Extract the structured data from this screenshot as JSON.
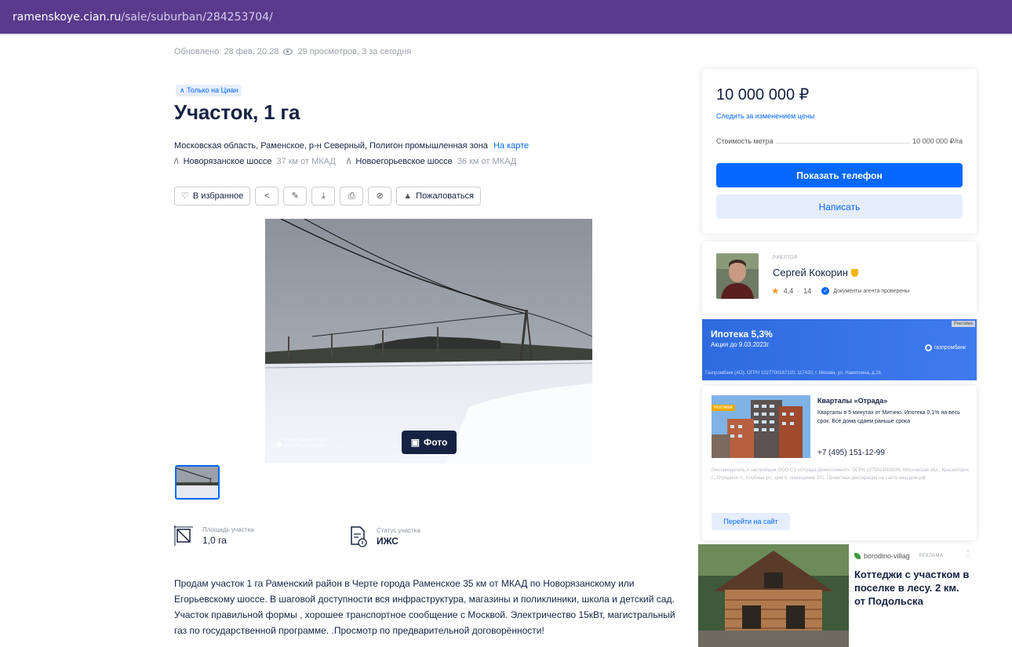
{
  "browser": {
    "url_host": "ramenskoye.cian.ru",
    "url_path": "/sale/suburban/284253704/"
  },
  "meta": {
    "updated": "Обновлено: 28 фев, 20:28",
    "views": "29 просмотров, 3 за сегодня"
  },
  "listing": {
    "badge": "Только на Циан",
    "title": "Участок, 1 га",
    "address": "Московская область, Раменское, р-н Северный, Полигон промышленная зона",
    "map_link": "На карте",
    "highways": [
      {
        "name": "Новорязанское шоссе",
        "distance": "37 км от МКАД"
      },
      {
        "name": "Новоегорьевское шоссе",
        "distance": "36 км от МКАД"
      }
    ]
  },
  "actions": {
    "favorite": "В избранное",
    "complain": "Пожаловаться"
  },
  "photo": {
    "button_label": "Фото",
    "watermark_line1": "SHOT ON MI 11 LE",
    "watermark_line2": "AI DUAL CAMERA"
  },
  "features": [
    {
      "label": "Площадь участка",
      "value": "1,0 га"
    },
    {
      "label": "Статус участка",
      "value": "ИЖС"
    }
  ],
  "description": "Продам участок 1 га Раменский район в Черте города Раменское 35 км от МКАД по Новорязанскому или Егорьевскому шоссе. В шаговой доступности вся инфраструктура, магазины и поликлиники, школа и детский сад. Участок правильной формы , хорошее транспортное сообщение с Москвой. Электричество 15кВт, магистральный газ по государственной программе. .Просмотр по предварительной договорённости!",
  "price_card": {
    "price": "10 000 000 ₽",
    "track_link": "Следить за изменением цены",
    "ppm_label": "Стоимость метра",
    "ppm_value": "10 000 000 ₽/га",
    "phone_button": "Показать телефон",
    "write_button": "Написать"
  },
  "agent": {
    "role": "РИЕЛТОР",
    "name": "Сергей Кокорин",
    "rating": "4,4",
    "reviews": "14",
    "verified": "Документы агента проверены"
  },
  "ads": {
    "mortgage": {
      "tag": "Реклама",
      "title": "Ипотека 5,3%",
      "subtitle": "Акция до 9.03.2023г",
      "logo": "газпромбанк",
      "legal": "Газпромбанк (АО). ОГРН 1027700167110. 117420, г. Москва, ул. Наметкина, д.16"
    },
    "otrada": {
      "badge": "РЕКЛАМА",
      "title": "Кварталы «Отрада»",
      "text": "Кварталы в 5 минутах от Митино. Ипотека 0,1% на весь срок. Все дома сдаем раньше срока",
      "phone": "+7 (495) 151-12-99",
      "legal": "Рекламодатель и застройщик ООО СЗ «Отрада Девелопмент», ОГРН 1075024008938, Московская обл., Красногорск г., Отрадное п., Клубная ул., дом 5, помещение 331. Проектная декларация на сайте наш.дом.рф",
      "button": "Перейти на сайт"
    },
    "borodino": {
      "site": "borodino-villag",
      "tag": "РЕКЛАМА",
      "text": "Коттеджи с участком в поселке в лесу. 2 км. от Подольска"
    }
  },
  "colors": {
    "brand_blue": "#0468ff",
    "text_dark": "#152242",
    "url_bar": "#5a3a8c"
  }
}
